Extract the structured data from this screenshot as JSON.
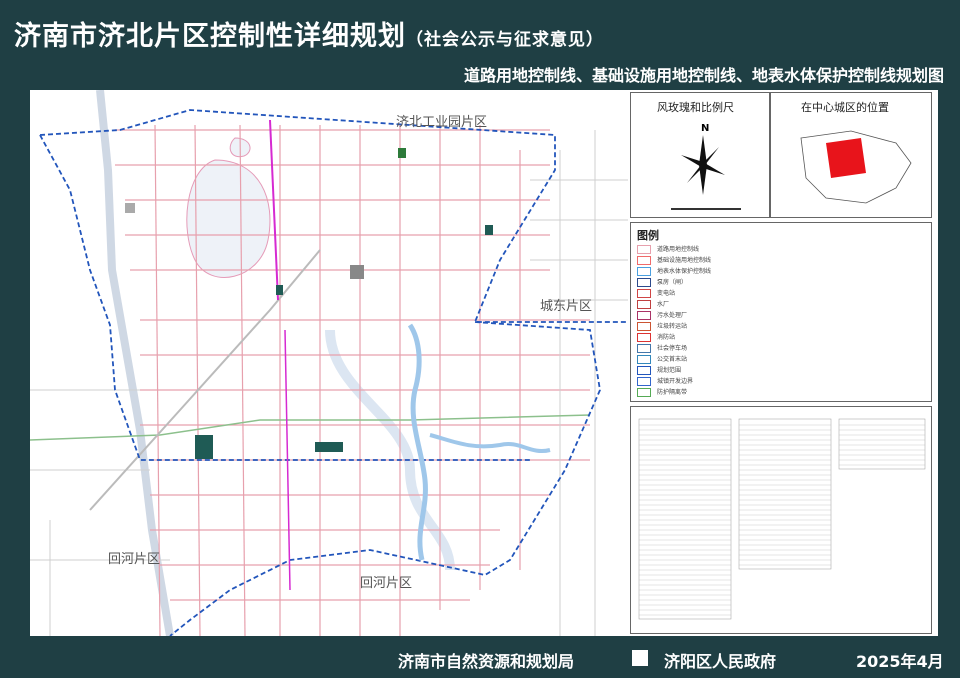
{
  "header": {
    "title": "济南市济北片区控制性详细规划",
    "subtitle": "（社会公示与征求意见）",
    "map_title": "道路用地控制线、基础设施用地控制线、地表水体保护控制线规划图"
  },
  "map": {
    "labels": {
      "industrial_park": "济北工业园片区",
      "chengdong": "城东片区",
      "huihe_west": "回河片区",
      "huihe_south": "回河片区"
    }
  },
  "sidebar": {
    "compass_title": "风玫瑰和比例尺",
    "location_title": "在中心城区的位置",
    "north_label": "N",
    "legend_title": "图例",
    "legend_items": [
      {
        "label": "道路用地控制线",
        "color": "#e7a0ad"
      },
      {
        "label": "基础设施用地控制线",
        "color": "#f06a6a"
      },
      {
        "label": "地表水体保护控制线",
        "color": "#4aa0e0"
      },
      {
        "label": "泵房（闸）",
        "color": "#2c4a8c"
      },
      {
        "label": "变电站",
        "color": "#d04545"
      },
      {
        "label": "水厂",
        "color": "#c04040"
      },
      {
        "label": "污水处理厂",
        "color": "#aa3366"
      },
      {
        "label": "垃圾转运站",
        "color": "#cc5533"
      },
      {
        "label": "消防站",
        "color": "#dd3333"
      },
      {
        "label": "社会停车场",
        "color": "#4477aa"
      },
      {
        "label": "公交首末站",
        "color": "#3388bb"
      },
      {
        "label": "规划范围",
        "color": "#2255bb"
      },
      {
        "label": "城镇开发边界",
        "color": "#3366cc"
      },
      {
        "label": "防护隔离带",
        "color": "#55aa55"
      }
    ],
    "colors": {
      "location_fill": "#e8141b"
    }
  },
  "footer": {
    "agency1": "济南市自然资源和规划局",
    "agency2": "济阳区人民政府",
    "date": "2025年4月"
  }
}
